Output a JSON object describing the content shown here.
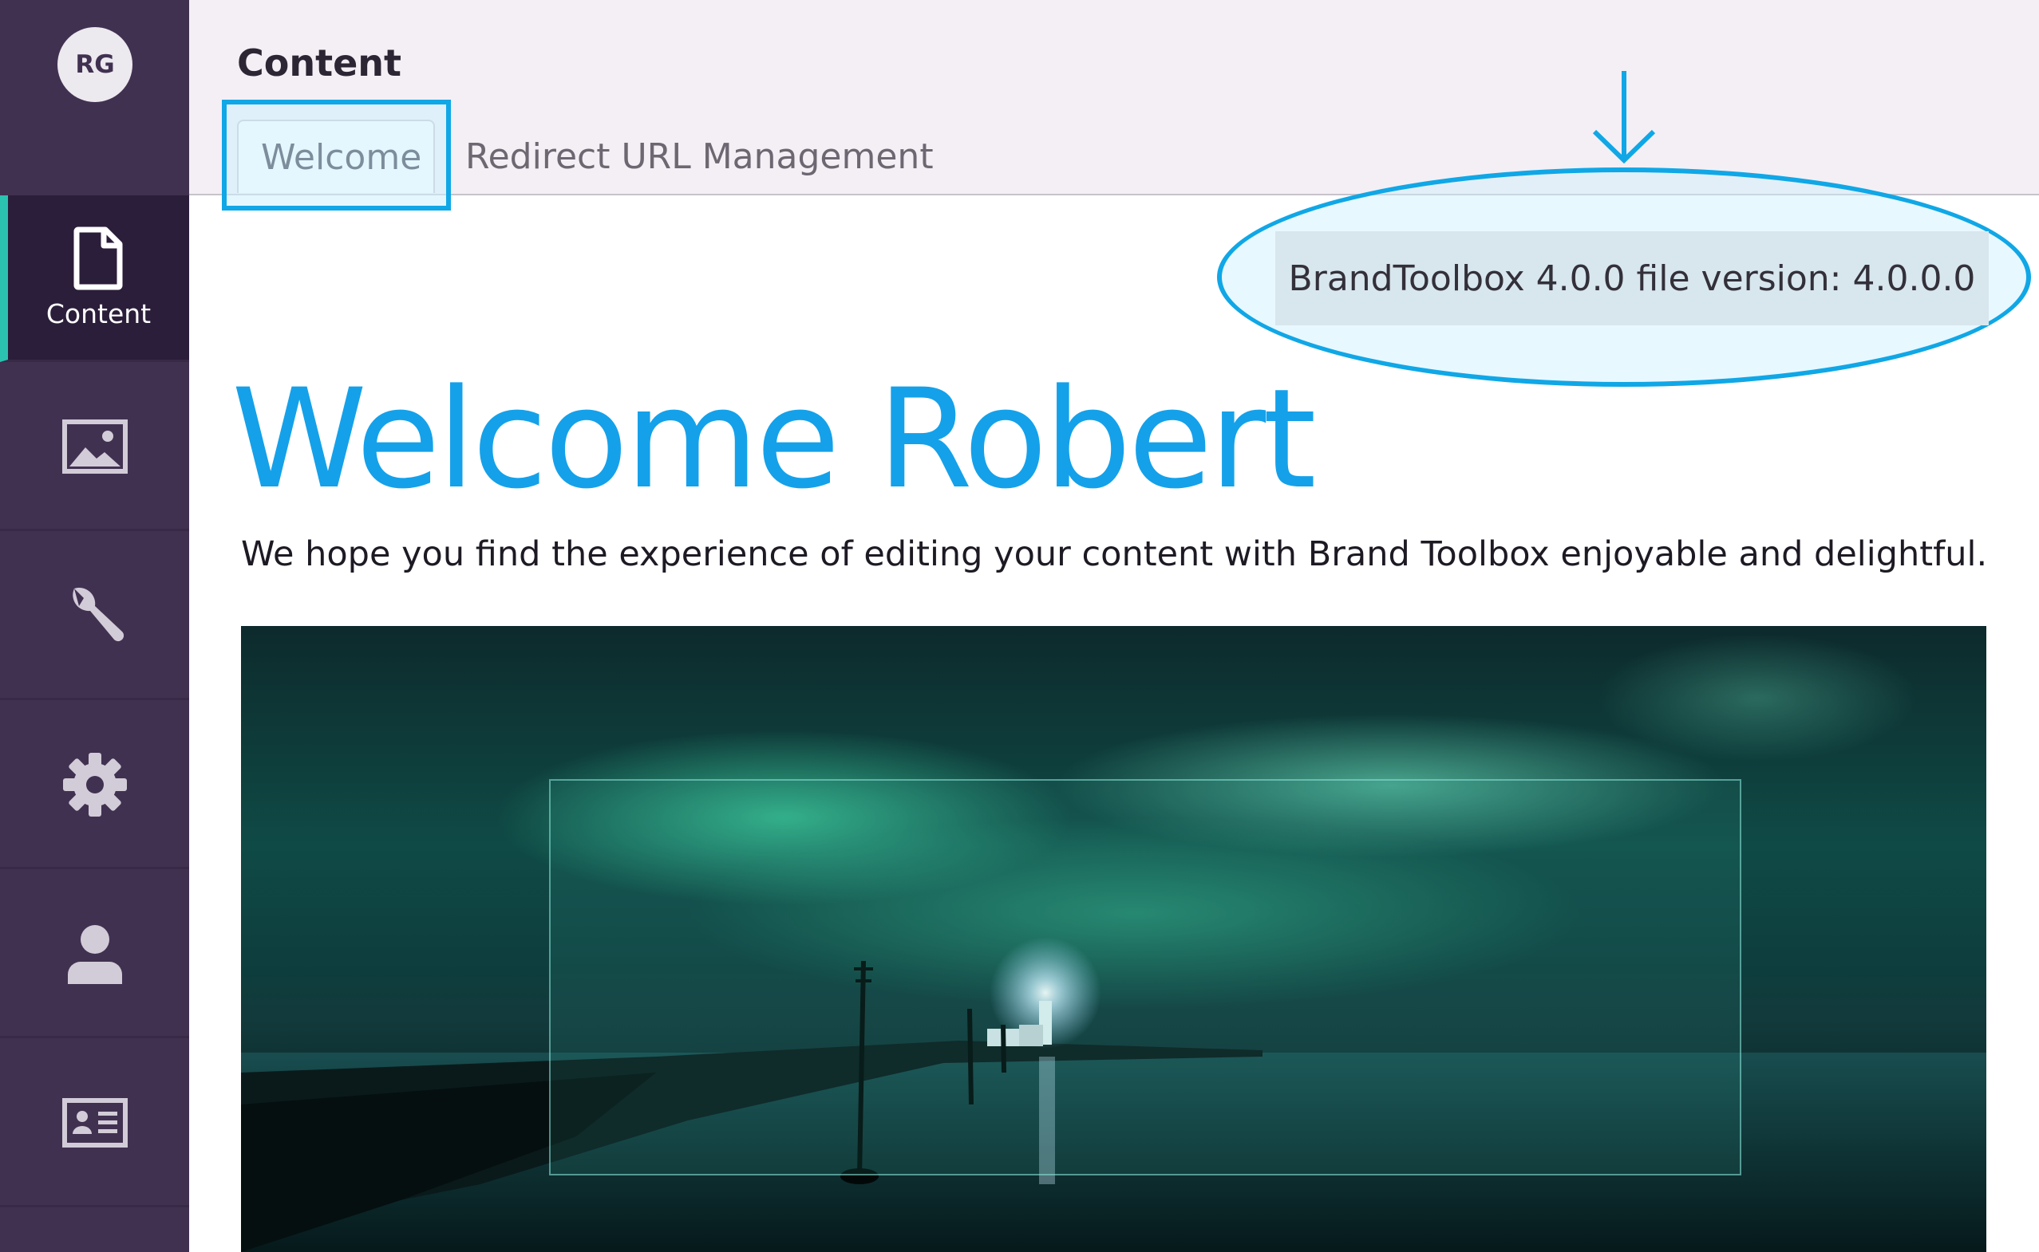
{
  "sidebar": {
    "avatar_initials": "RG",
    "items": [
      {
        "label": "Content",
        "icon": "document-icon",
        "active": true
      },
      {
        "label": "",
        "icon": "image-icon"
      },
      {
        "label": "",
        "icon": "wrench-icon"
      },
      {
        "label": "",
        "icon": "gear-icon"
      },
      {
        "label": "",
        "icon": "user-icon"
      },
      {
        "label": "",
        "icon": "id-card-icon"
      }
    ]
  },
  "header": {
    "title": "Content",
    "tabs": [
      {
        "label": "Welcome",
        "active": true
      },
      {
        "label": "Redirect URL Management"
      }
    ]
  },
  "version": {
    "text": "BrandToolbox 4.0.0 file version: 4.0.0.0"
  },
  "main": {
    "welcome_title": "Welcome Robert",
    "welcome_text": "We hope you find the experience of editing your content with Brand Toolbox enjoyable and delightful."
  },
  "colors": {
    "sidebar_bg": "#413151",
    "active_accent": "#2bc2b0",
    "header_bg": "#f4eff5",
    "title_blue": "#14a1ea",
    "annotation_blue": "#10a7e6"
  }
}
